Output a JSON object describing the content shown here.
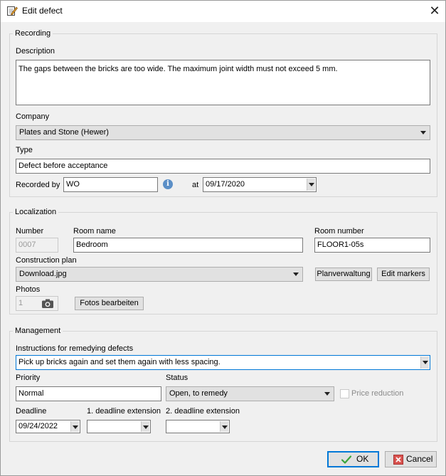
{
  "window": {
    "title": "Edit defect",
    "close_glyph": "✕"
  },
  "recording": {
    "legend": "Recording",
    "description_label": "Description",
    "description_value": "The gaps between the bricks are too wide. The maximum joint width must not exceed 5 mm.",
    "company_label": "Company",
    "company_value": "Plates and Stone (Hewer)",
    "type_label": "Type",
    "type_value": "Defect before acceptance",
    "recorded_by_label": "Recorded by",
    "recorded_by_value": "WO",
    "info_glyph": "i",
    "at_label": "at",
    "date_value": "09/17/2020"
  },
  "localization": {
    "legend": "Localization",
    "number_label": "Number",
    "number_value": "0007",
    "room_name_label": "Room name",
    "room_name_value": "Bedroom",
    "room_number_label": "Room number",
    "room_number_value": "FLOOR1-05s",
    "construction_plan_label": "Construction plan",
    "construction_plan_value": "Download.jpg",
    "plan_manage_button": "Planverwaltung",
    "edit_markers_button": "Edit markers",
    "photos_label": "Photos",
    "photos_count": "1",
    "edit_photos_button": "Fotos bearbeiten"
  },
  "management": {
    "legend": "Management",
    "instructions_label": "Instructions for remedying defects",
    "instructions_value": "Pick up bricks again and set them again with less spacing.",
    "priority_label": "Priority",
    "priority_value": "Normal",
    "status_label": "Status",
    "status_value": "Open, to remedy",
    "price_reduction_label": "Price reduction",
    "deadline_label": "Deadline",
    "deadline_value": "09/24/2022",
    "ext1_label": "1. deadline extension",
    "ext1_value": "",
    "ext2_label": "2. deadline extension",
    "ext2_value": ""
  },
  "footer": {
    "ok_label": "OK",
    "cancel_label": "Cancel"
  },
  "colors": {
    "accent": "#0078d7",
    "info": "#5b8fc7",
    "ok_check": "#3aa53a",
    "cancel_red": "#d9534f"
  },
  "icons": [
    "edit-note-icon",
    "close-icon",
    "info-icon",
    "camera-icon",
    "dropdown-arrow-icon",
    "checkmark-icon",
    "cancel-icon"
  ]
}
